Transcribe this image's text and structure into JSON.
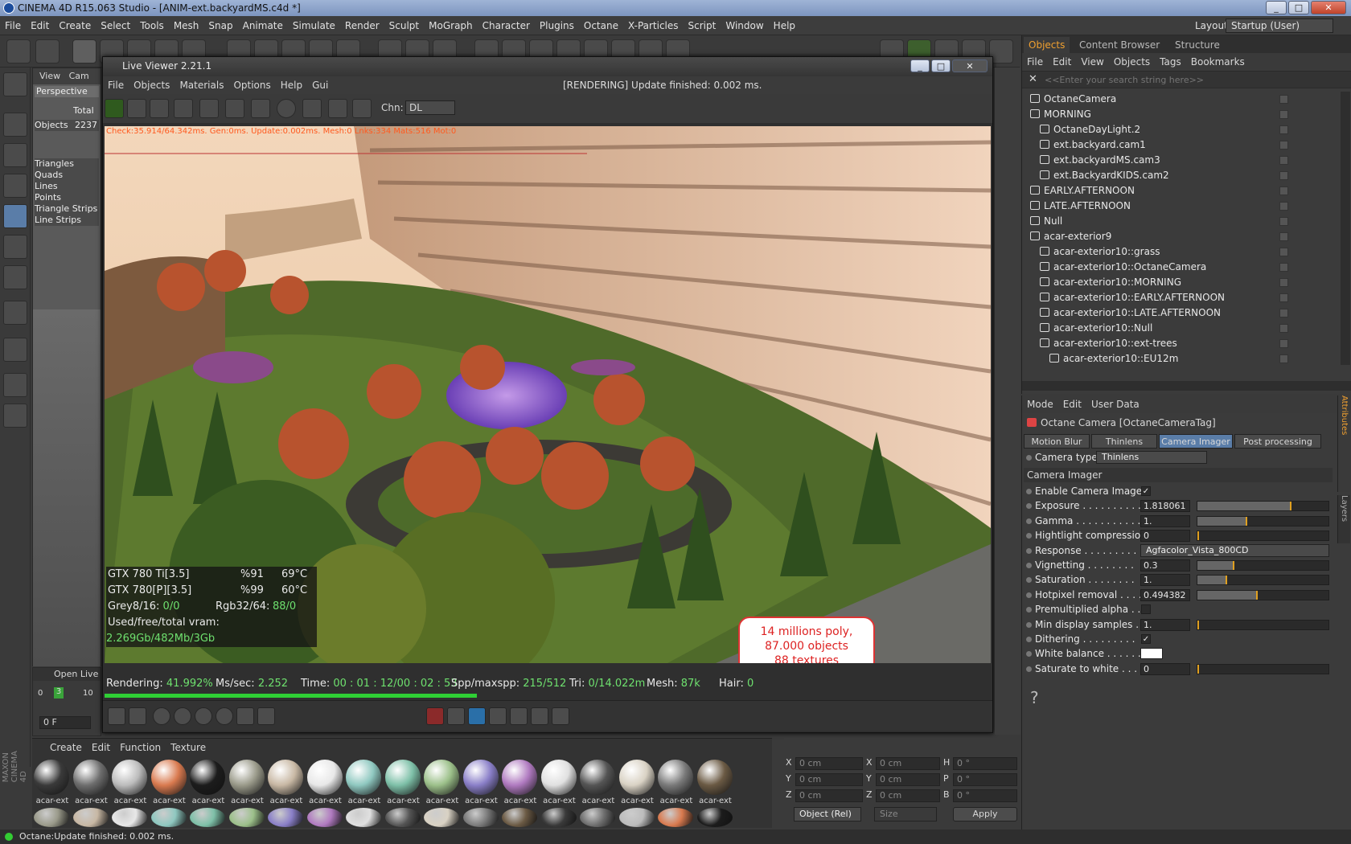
{
  "window": {
    "title": "CINEMA 4D R15.063 Studio - [ANIM-ext.backyardMS.c4d *]",
    "minimize": "_",
    "maximize": "□",
    "close": "✕"
  },
  "menubar": [
    "File",
    "Edit",
    "Create",
    "Select",
    "Tools",
    "Mesh",
    "Snap",
    "Animate",
    "Simulate",
    "Render",
    "Sculpt",
    "MoGraph",
    "Character",
    "Plugins",
    "Octane",
    "X-Particles",
    "Script",
    "Window",
    "Help"
  ],
  "layout": {
    "label": "Layout:",
    "value": "Startup (User)"
  },
  "viewport": {
    "menu": [
      "View",
      "Cam"
    ],
    "name": "Perspective",
    "total_label": "Total",
    "objects_label": "Objects",
    "objects_value": "2237",
    "stats": [
      "Triangles",
      "Quads",
      "Lines",
      "Points",
      "Triangle Strips",
      "Line Strips"
    ]
  },
  "live_viewer": {
    "title": "Live Viewer 2.21.1",
    "menu": [
      "File",
      "Objects",
      "Materials",
      "Options",
      "Help",
      "Gui"
    ],
    "status": "[RENDERING] Update finished: 0.002 ms.",
    "chn_label": "Chn:",
    "chn_value": "DL",
    "stats_line": "Check:35.914/64.342ms. Gen:0ms. Update:0.002ms. Mesh:0 Lnks:334 Mats:516 Mot:0",
    "callout": [
      "14 millions poly,",
      "87.000 objects",
      "88 textures"
    ],
    "gpu": [
      {
        "name": "GTX 780 Ti[3.5]",
        "util": "%91",
        "temp": "69°C"
      },
      {
        "name": "GTX 780[P][3.5]",
        "util": "%99",
        "temp": "60°C"
      }
    ],
    "grey_label": "Grey8/16:",
    "grey_value": "0/0",
    "rgb_label": "Rgb32/64:",
    "rgb_value": "88/0",
    "vram_label": "Used/free/total vram:",
    "vram_value": "2.269Gb/482Mb/3Gb",
    "rendering_label": "Rendering:",
    "rendering_value": "41.992%",
    "mssec_label": "Ms/sec:",
    "mssec_value": "2.252",
    "time_label": "Time:",
    "time_value": "00 : 01 : 12/00 : 02 : 53",
    "spp_label": "Spp/maxspp:",
    "spp_value": "215/512",
    "tri_label": "Tri:",
    "tri_value": "0/14.022m",
    "mesh_label": "Mesh:",
    "mesh_value": "87k",
    "hair_label": "Hair:",
    "hair_value": "0",
    "progress": 0.42
  },
  "object_manager": {
    "tabs": [
      "Objects",
      "Content Browser",
      "Structure"
    ],
    "menu": [
      "File",
      "Edit",
      "View",
      "Objects",
      "Tags",
      "Bookmarks"
    ],
    "search_placeholder": "<<Enter your search string here>>",
    "rows": [
      {
        "label": "OctaneCamera",
        "indent": 0
      },
      {
        "label": "MORNING",
        "indent": 0
      },
      {
        "label": "OctaneDayLight.2",
        "indent": 1
      },
      {
        "label": "ext.backyard.cam1",
        "indent": 1
      },
      {
        "label": "ext.backyardMS.cam3",
        "indent": 1
      },
      {
        "label": "ext.BackyardKIDS.cam2",
        "indent": 1
      },
      {
        "label": "EARLY.AFTERNOON",
        "indent": 0
      },
      {
        "label": "LATE.AFTERNOON",
        "indent": 0
      },
      {
        "label": "Null",
        "indent": 0
      },
      {
        "label": "acar-exterior9",
        "indent": 0
      },
      {
        "label": "acar-exterior10::grass",
        "indent": 1
      },
      {
        "label": "acar-exterior10::OctaneCamera",
        "indent": 1
      },
      {
        "label": "acar-exterior10::MORNING",
        "indent": 1
      },
      {
        "label": "acar-exterior10::EARLY.AFTERNOON",
        "indent": 1
      },
      {
        "label": "acar-exterior10::LATE.AFTERNOON",
        "indent": 1
      },
      {
        "label": "acar-exterior10::Null",
        "indent": 1
      },
      {
        "label": "acar-exterior10::ext-trees",
        "indent": 1
      },
      {
        "label": "acar-exterior10::EU12m",
        "indent": 2
      }
    ]
  },
  "attributes": {
    "menu": [
      "Mode",
      "Edit",
      "User Data"
    ],
    "header": "Octane Camera [OctaneCameraTag]",
    "tabs": [
      "Motion Blur",
      "Thinlens",
      "Camera Imager",
      "Post processing"
    ],
    "camera_type_label": "Camera type",
    "camera_type_value": "Thinlens",
    "section": "Camera Imager",
    "side_tabs": [
      "Attributes",
      "Layers"
    ],
    "params": [
      {
        "label": "Enable Camera Imager",
        "kind": "check",
        "value": "✓"
      },
      {
        "label": "Exposure . . . . . . . . . .",
        "kind": "slider",
        "value": "1.818061",
        "level": 0.72
      },
      {
        "label": "Gamma . . . . . . . . . . .",
        "kind": "slider",
        "value": "1.",
        "level": 0.38
      },
      {
        "label": "Hightlight compression",
        "kind": "slider",
        "value": "0",
        "level": 0.0
      },
      {
        "label": "Response . . . . . . . . .",
        "kind": "dropdown",
        "value": "Agfacolor_Vista_800CD"
      },
      {
        "label": "Vignetting . . . . . . . .",
        "kind": "slider",
        "value": "0.3",
        "level": 0.28
      },
      {
        "label": "Saturation . . . . . . . .",
        "kind": "slider",
        "value": "1.",
        "level": 0.23
      },
      {
        "label": "Hotpixel removal . . . .",
        "kind": "slider",
        "value": "0.494382",
        "level": 0.46
      },
      {
        "label": "Premultiplied alpha . .",
        "kind": "check",
        "value": ""
      },
      {
        "label": "Min display samples . .",
        "kind": "slider",
        "value": "1.",
        "level": 0.0
      },
      {
        "label": "Dithering . . . . . . . . .",
        "kind": "check",
        "value": "✓"
      },
      {
        "label": "White balance . . . . . .",
        "kind": "color",
        "value": ""
      },
      {
        "label": "Saturate to white . . . .",
        "kind": "slider",
        "value": "0",
        "level": 0.0
      }
    ],
    "help": "?"
  },
  "timeline": {
    "label": "Open Live",
    "start": "0",
    "current": "3",
    "end": "10",
    "frame": "0 F"
  },
  "material_manager": {
    "menu": [
      "Create",
      "Edit",
      "Function",
      "Texture"
    ],
    "material_label": "acar-ext"
  },
  "coordinates": {
    "rows": [
      {
        "a": "X",
        "av": "0 cm",
        "b": "X",
        "bv": "0 cm",
        "c": "H",
        "cv": "0 °"
      },
      {
        "a": "Y",
        "av": "0 cm",
        "b": "Y",
        "bv": "0 cm",
        "c": "P",
        "cv": "0 °"
      },
      {
        "a": "Z",
        "av": "0 cm",
        "b": "Z",
        "bv": "0 cm",
        "c": "B",
        "cv": "0 °"
      }
    ],
    "mode": "Object (Rel)",
    "size": "Size",
    "apply": "Apply"
  },
  "statusbar": "Octane:Update finished: 0.002 ms.",
  "brand": "MAXON CINEMA 4D"
}
